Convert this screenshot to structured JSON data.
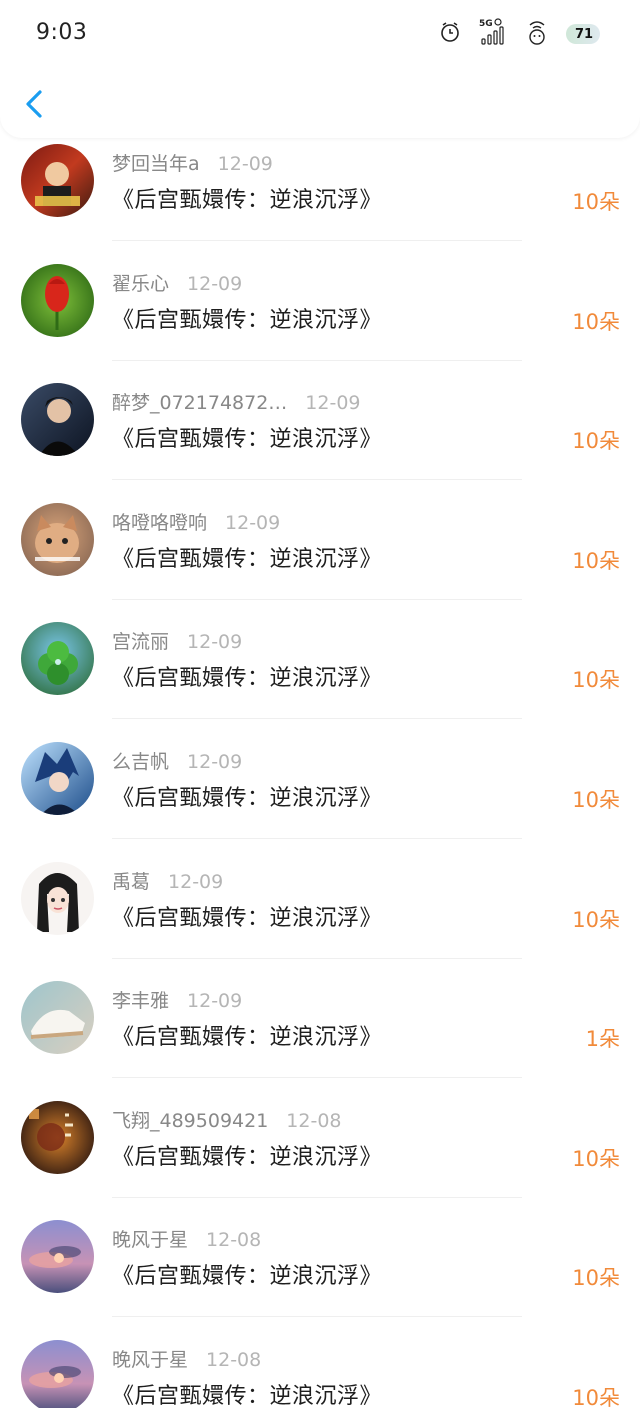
{
  "status_bar": {
    "time": "9:03",
    "network": "5G",
    "battery": "71"
  },
  "colors": {
    "accent_blue": "#1a9df0",
    "amount_orange": "#f18a3a"
  },
  "items": [
    {
      "user": "梦回当年a",
      "date": "12-09",
      "title": "《后宫甄嬛传：逆浪沉浮》",
      "amount": "10朵",
      "avatar": "movie-poster"
    },
    {
      "user": "翟乐心",
      "date": "12-09",
      "title": "《后宫甄嬛传：逆浪沉浮》",
      "amount": "10朵",
      "avatar": "red-tulip"
    },
    {
      "user": "醉梦_072174872…",
      "date": "12-09",
      "title": "《后宫甄嬛传：逆浪沉浮》",
      "amount": "10朵",
      "avatar": "man-portrait"
    },
    {
      "user": "咯噔咯噔响",
      "date": "12-09",
      "title": "《后宫甄嬛传：逆浪沉浮》",
      "amount": "10朵",
      "avatar": "cat"
    },
    {
      "user": "宫流丽",
      "date": "12-09",
      "title": "《后宫甄嬛传：逆浪沉浮》",
      "amount": "10朵",
      "avatar": "clover"
    },
    {
      "user": "么吉帆",
      "date": "12-09",
      "title": "《后宫甄嬛传：逆浪沉浮》",
      "amount": "10朵",
      "avatar": "anime-blue-hair"
    },
    {
      "user": "禹葛",
      "date": "12-09",
      "title": "《后宫甄嬛传：逆浪沉浮》",
      "amount": "10朵",
      "avatar": "anime-girl"
    },
    {
      "user": "李丰雅",
      "date": "12-09",
      "title": "《后宫甄嬛传：逆浪沉浮》",
      "amount": "1朵",
      "avatar": "sneakers"
    },
    {
      "user": "飞翔_489509421",
      "date": "12-08",
      "title": "《后宫甄嬛传：逆浪沉浮》",
      "amount": "10朵",
      "avatar": "dark-art"
    },
    {
      "user": "晚风于星",
      "date": "12-08",
      "title": "《后宫甄嬛传：逆浪沉浮》",
      "amount": "10朵",
      "avatar": "sunset-sky"
    },
    {
      "user": "晚风于星",
      "date": "12-08",
      "title": "《后宫甄嬛传：逆浪沉浮》",
      "amount": "10朵",
      "avatar": "sunset-sky"
    }
  ]
}
